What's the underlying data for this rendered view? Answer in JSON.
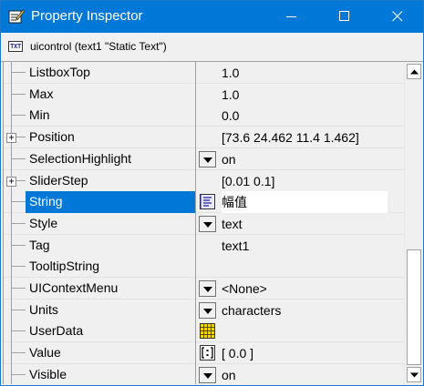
{
  "window": {
    "title": "Property Inspector",
    "object_icon_text": "TXT",
    "object_label": "uicontrol (text1 \"Static Text\")"
  },
  "properties": [
    {
      "name": "ListboxTop",
      "value": "1.0",
      "control": "none",
      "expandable": false,
      "selected": false
    },
    {
      "name": "Max",
      "value": "1.0",
      "control": "none",
      "expandable": false,
      "selected": false
    },
    {
      "name": "Min",
      "value": "0.0",
      "control": "none",
      "expandable": false,
      "selected": false
    },
    {
      "name": "Position",
      "value": "[73.6 24.462 11.4 1.462]",
      "control": "none",
      "expandable": true,
      "selected": false
    },
    {
      "name": "SelectionHighlight",
      "value": "on",
      "control": "dropdown",
      "expandable": false,
      "selected": false
    },
    {
      "name": "SliderStep",
      "value": "[0.01 0.1]",
      "control": "none",
      "expandable": true,
      "selected": false
    },
    {
      "name": "String",
      "value": "幅值",
      "control": "text-editor",
      "expandable": false,
      "selected": true
    },
    {
      "name": "Style",
      "value": "text",
      "control": "dropdown",
      "expandable": false,
      "selected": false
    },
    {
      "name": "Tag",
      "value": "text1",
      "control": "none",
      "expandable": false,
      "selected": false
    },
    {
      "name": "TooltipString",
      "value": "",
      "control": "none",
      "expandable": false,
      "selected": false
    },
    {
      "name": "UIContextMenu",
      "value": "<None>",
      "control": "dropdown",
      "expandable": false,
      "selected": false
    },
    {
      "name": "Units",
      "value": "characters",
      "control": "dropdown",
      "expandable": false,
      "selected": false
    },
    {
      "name": "UserData",
      "value": "",
      "control": "grid-editor",
      "expandable": false,
      "selected": false
    },
    {
      "name": "Value",
      "value": "[ 0.0 ]",
      "control": "array-editor",
      "expandable": false,
      "selected": false
    },
    {
      "name": "Visible",
      "value": "on",
      "control": "dropdown",
      "expandable": false,
      "selected": false
    }
  ],
  "colors": {
    "title_bar": "#0078d7",
    "selection": "#0078d7",
    "panel": "#f0f0f0"
  },
  "icons": {
    "app": "property-inspector-icon",
    "object": "static-text-icon",
    "dropdown": "chevron-down-icon",
    "text_editor": "text-lines-icon",
    "grid_editor": "grid-table-icon",
    "array_editor": "array-brackets-icon"
  }
}
